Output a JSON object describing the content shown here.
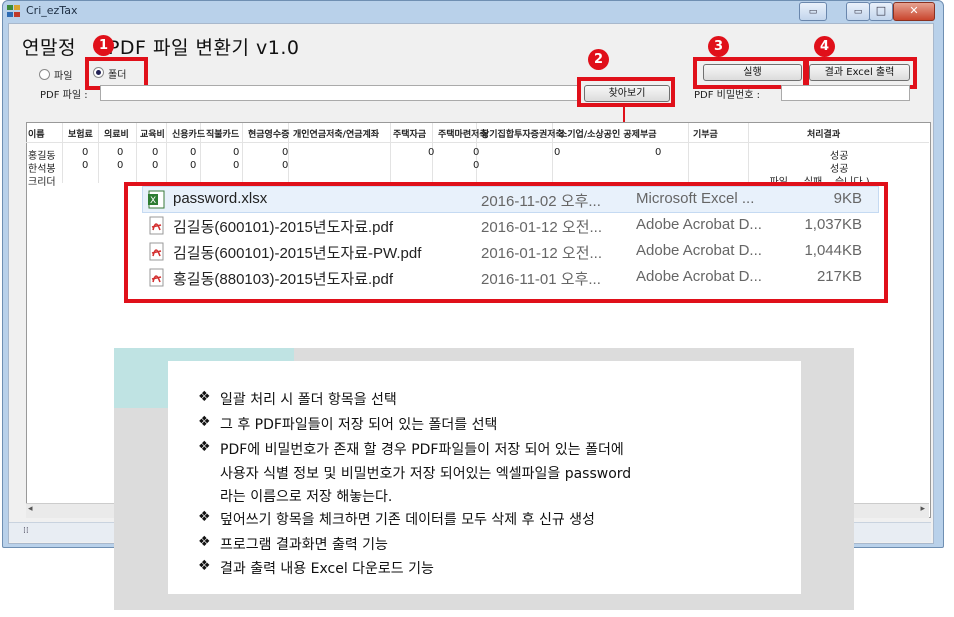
{
  "window": {
    "title": "Cri_ezTax",
    "controls": {
      "minimize": "▭",
      "restore": "▭",
      "maximize": "□",
      "close": "✕"
    }
  },
  "app": {
    "heading": "연말정산 PDF 파일 변환기 v1.0",
    "heading_part1": "연말정",
    "heading_part2": "PDF 파일 변환기 v1.0"
  },
  "callouts": {
    "one": "1",
    "two": "2",
    "three": "3",
    "four": "4"
  },
  "mode": {
    "file_label": "파일",
    "folder_label": "폴더",
    "selected": "폴더"
  },
  "pdf_file": {
    "label": "PDF 파일 :",
    "value": ""
  },
  "browse_button": "찾아보기",
  "pdf_password": {
    "label": "PDF 비밀번호 :",
    "value": ""
  },
  "run_button": "실행",
  "excel_button": "결과 Excel 출력",
  "table": {
    "columns": [
      "이름",
      "보험료",
      "의료비",
      "교육비",
      "신용카드",
      "직불카드",
      "현금영수증",
      "개인연금저축/연금계좌",
      "주택자금",
      "주택마련저축",
      "장기집합투자증권저축",
      "소기업/소상공인 공제부금",
      "기부금",
      "처리결과"
    ],
    "rows": [
      {
        "name": "홍길동",
        "values": [
          "0",
          "0",
          "0",
          "0",
          "0",
          "0",
          "0",
          "0",
          "0",
          "0",
          "0",
          "0"
        ],
        "result": "성공"
      },
      {
        "name": "한석봉",
        "values": [
          "0",
          "0",
          "0",
          "0",
          "0",
          "0",
          "",
          "",
          "0",
          "",
          "",
          "",
          ""
        ],
        "result": "성공"
      },
      {
        "name": "크리더",
        "values": [],
        "result": "...파일 ... 실패 ...습니다.)"
      }
    ]
  },
  "file_list": [
    {
      "icon": "excel-file-icon",
      "name": "password.xlsx",
      "date": "2016-11-02 오후...",
      "type": "Microsoft Excel ...",
      "size": "9KB"
    },
    {
      "icon": "pdf-file-icon",
      "name": "김길동(600101)-2015년도자료.pdf",
      "date": "2016-01-12 오전...",
      "type": "Adobe Acrobat D...",
      "size": "1,037KB"
    },
    {
      "icon": "pdf-file-icon",
      "name": "김길동(600101)-2015년도자료-PW.pdf",
      "date": "2016-01-12 오전...",
      "type": "Adobe Acrobat D...",
      "size": "1,044KB"
    },
    {
      "icon": "pdf-file-icon",
      "name": "홍길동(880103)-2015년도자료.pdf",
      "date": "2016-11-01 오후...",
      "type": "Adobe Acrobat D...",
      "size": "217KB"
    }
  ],
  "notes": [
    {
      "bullet": "❖",
      "text": "일괄 처리 시 폴더 항목을 선택"
    },
    {
      "bullet": "❖",
      "text": "그 후 PDF파일들이 저장 되어 있는 폴더를 선택"
    },
    {
      "bullet": "❖",
      "text": "PDF에 비밀번호가 존재 할 경우 PDF파일들이 저장 되어 있는 폴더에"
    },
    {
      "bullet": "",
      "text": "사용자 식별 정보 및 비밀번호가 저장 되어있는 엑셀파일을 password"
    },
    {
      "bullet": "",
      "text": "라는 이름으로 저장 해놓는다."
    },
    {
      "bullet": "❖",
      "text": "덮어쓰기 항목을 체크하면 기존 데이터를 모두 삭제 후 신규 생성"
    },
    {
      "bullet": "❖",
      "text": "프로그램 결과화면 출력 기능"
    },
    {
      "bullet": "❖",
      "text": "결과 출력 내용 Excel 다운로드 기능"
    }
  ],
  "colors": {
    "callout_red": "#e0101a",
    "accent_teal": "#bfe3e3",
    "note_bg": "#dcdcdc"
  }
}
